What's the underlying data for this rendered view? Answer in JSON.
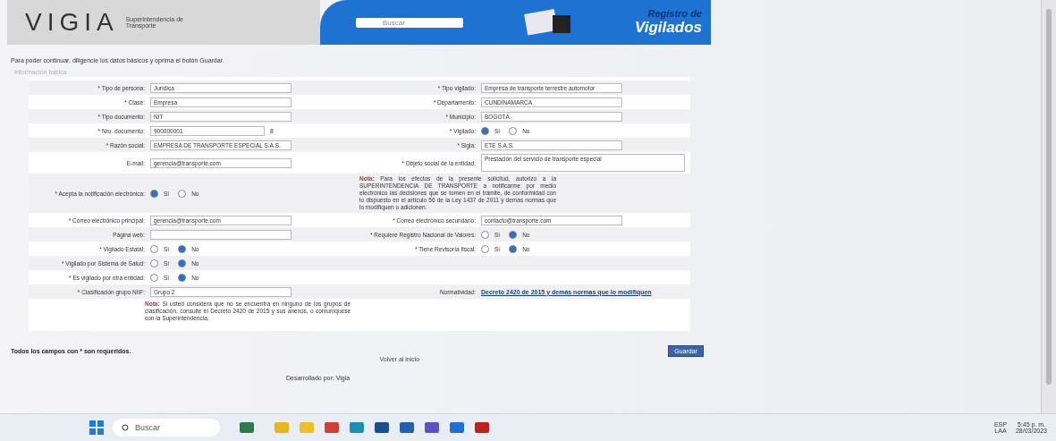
{
  "header": {
    "logo": "VIGIA",
    "subtitle": "Superintendencia de Transporte",
    "search_placeholder": "Buscar",
    "title_line1": "Registro de",
    "title_line2": "Vigilados"
  },
  "intro": "Para poder continuar, diligencie los datos básicos y oprima el botón Guardar.",
  "section": "Información básica",
  "rows": [
    {
      "left": {
        "label": "* Tipo de persona:",
        "kind": "select",
        "value": "Jurídica"
      },
      "right": {
        "label": "* Tipo vigilado:",
        "kind": "select",
        "value": "Empresa de transporte terrestre automotor"
      }
    },
    {
      "left": {
        "label": "* Clase:",
        "kind": "select",
        "value": "Empresa"
      },
      "right": {
        "label": "* Departamento:",
        "kind": "select",
        "value": "CUNDINAMARCA"
      }
    },
    {
      "left": {
        "label": "* Tipo documento:",
        "kind": "select",
        "value": "NIT"
      },
      "right": {
        "label": "* Municipio:",
        "kind": "select",
        "value": "BOGOTÁ"
      }
    },
    {
      "left": {
        "label": "* Nro. documento:",
        "kind": "text",
        "value": "900000001",
        "suffix": "8"
      },
      "right": {
        "label": "* Vigilado:",
        "kind": "radio",
        "options": [
          {
            "label": "Sí",
            "selected": true
          },
          {
            "label": "No",
            "selected": false
          }
        ]
      }
    },
    {
      "left": {
        "label": "* Razón social:",
        "kind": "text",
        "value": "EMPRESA DE TRANSPORTE ESPECIAL S.A.S."
      },
      "right": {
        "label": "* Sigla:",
        "kind": "text",
        "value": "ETE S.A.S."
      }
    },
    {
      "left": {
        "label": "E-mail:",
        "kind": "text",
        "value": "gerencia@transporte.com"
      },
      "right": {
        "label": "* Objeto social de la entidad:",
        "kind": "textarea",
        "value": "Prestación del servicio de transporte especial"
      }
    },
    {
      "left": {
        "label": "* Acepta la notificación electrónica:",
        "kind": "radio",
        "options": [
          {
            "label": "Sí",
            "selected": true
          },
          {
            "label": "No",
            "selected": false
          }
        ]
      },
      "right": {
        "kind": "note",
        "value": "**Nota:** Para los efectos de la presente solicitud, autorizo a la SUPERINTENDENCIA DE TRANSPORTE a notificarme por medio electrónico las decisiones que se tomen en el trámite, de conformidad con lo dispuesto en el artículo 56 de la Ley 1437 de 2011 y demás normas que lo modifiquen o adicionen."
      }
    },
    {
      "left": {
        "label": "* Correo electrónico principal:",
        "kind": "text",
        "value": "gerencia@transporte.com"
      },
      "right": {
        "label": "* Correo electrónico secundario:",
        "kind": "text",
        "value": "contacto@transporte.com"
      }
    },
    {
      "left": {
        "label": "Página web:",
        "kind": "text"
      },
      "right": {
        "label": "* Requiere Registro Nacional de Valores:",
        "kind": "radio",
        "options": [
          {
            "label": "Sí",
            "selected": false
          },
          {
            "label": "No",
            "selected": true
          }
        ]
      }
    },
    {
      "left": {
        "label": "* Vigilado Estatal:",
        "kind": "radio",
        "options": [
          {
            "label": "Sí",
            "selected": false
          },
          {
            "label": "No",
            "selected": true
          }
        ]
      },
      "right": {
        "label": "* Tiene Revisoría fiscal:",
        "kind": "radio",
        "options": [
          {
            "label": "Sí",
            "selected": false
          },
          {
            "label": "No",
            "selected": true
          }
        ]
      }
    },
    {
      "left": {
        "label": "* Vigilado por Sistema de Salud:",
        "kind": "radio",
        "options": [
          {
            "label": "Sí",
            "selected": false
          },
          {
            "label": "No",
            "selected": true
          }
        ]
      }
    },
    {
      "left": {
        "label": "* Es vigilado por otra entidad:",
        "kind": "radio",
        "options": [
          {
            "label": "Sí",
            "selected": false
          },
          {
            "label": "No",
            "selected": true
          }
        ]
      }
    },
    {
      "left": {
        "label": "* Clasificación grupo NIIF:",
        "kind": "select",
        "value": "Grupo 2"
      },
      "right": {
        "label": "Normatividad:",
        "kind": "link",
        "value": "Decreto 2420 de 2015 y demás normas que lo modifiquen"
      }
    },
    {
      "left": {
        "kind": "note",
        "value": "**Nota:** Si usted considera que no se encuentra en ninguno de los grupos de clasificación, consulte el Decreto 2420 de 2015 y sus anexos, o comuníquese con la Superintendencia."
      }
    }
  ],
  "required_note": "Todos los campos con * son requeridos.",
  "back_link": "Volver al inicio",
  "save_button": "Guardar",
  "credits": "Desarrollado por: Vigia",
  "taskbar": {
    "search": "Buscar",
    "lang1": "ESP",
    "lang2": "LAA",
    "time": "5:45 p. m.",
    "date": "28/03/2023"
  }
}
